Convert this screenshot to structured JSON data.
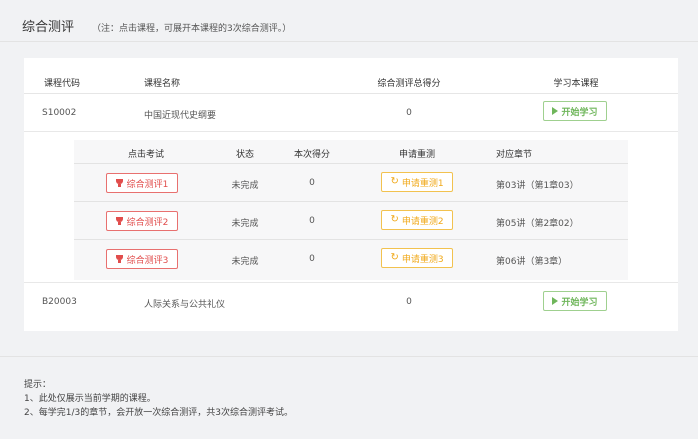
{
  "header": {
    "title": "综合测评",
    "note": "（注：点击课程，可展开本课程的3次综合测评。）"
  },
  "table": {
    "columns": [
      "课程代码",
      "课程名称",
      "综合测评总得分",
      "学习本课程"
    ],
    "courses": [
      {
        "code": "S10002",
        "name": "中国近现代史纲要",
        "score": "0",
        "action": "开始学习"
      },
      {
        "code": "B20003",
        "name": "人际关系与公共礼仪",
        "score": "0",
        "action": "开始学习"
      }
    ]
  },
  "sub_table": {
    "columns": [
      "点击考试",
      "状态",
      "本次得分",
      "申请重测",
      "对应章节"
    ],
    "rows": [
      {
        "exam": "综合测评1",
        "status": "未完成",
        "score": "0",
        "retest": "申请重测1",
        "chapter": "第03讲（第1章03）"
      },
      {
        "exam": "综合测评2",
        "status": "未完成",
        "score": "0",
        "retest": "申请重测2",
        "chapter": "第05讲（第2章02）"
      },
      {
        "exam": "综合测评3",
        "status": "未完成",
        "score": "0",
        "retest": "申请重测3",
        "chapter": "第06讲（第3章）"
      }
    ]
  },
  "tips": {
    "title": "提示：",
    "lines": [
      "1、此处仅展示当前学期的课程。",
      "2、每学完1/3的章节，会开放一次综合测评，共3次综合测评考试。"
    ]
  },
  "colors": {
    "start_green": "#6fb65b",
    "eval_red": "#e14d4c",
    "retest_orange": "#f0a818"
  }
}
